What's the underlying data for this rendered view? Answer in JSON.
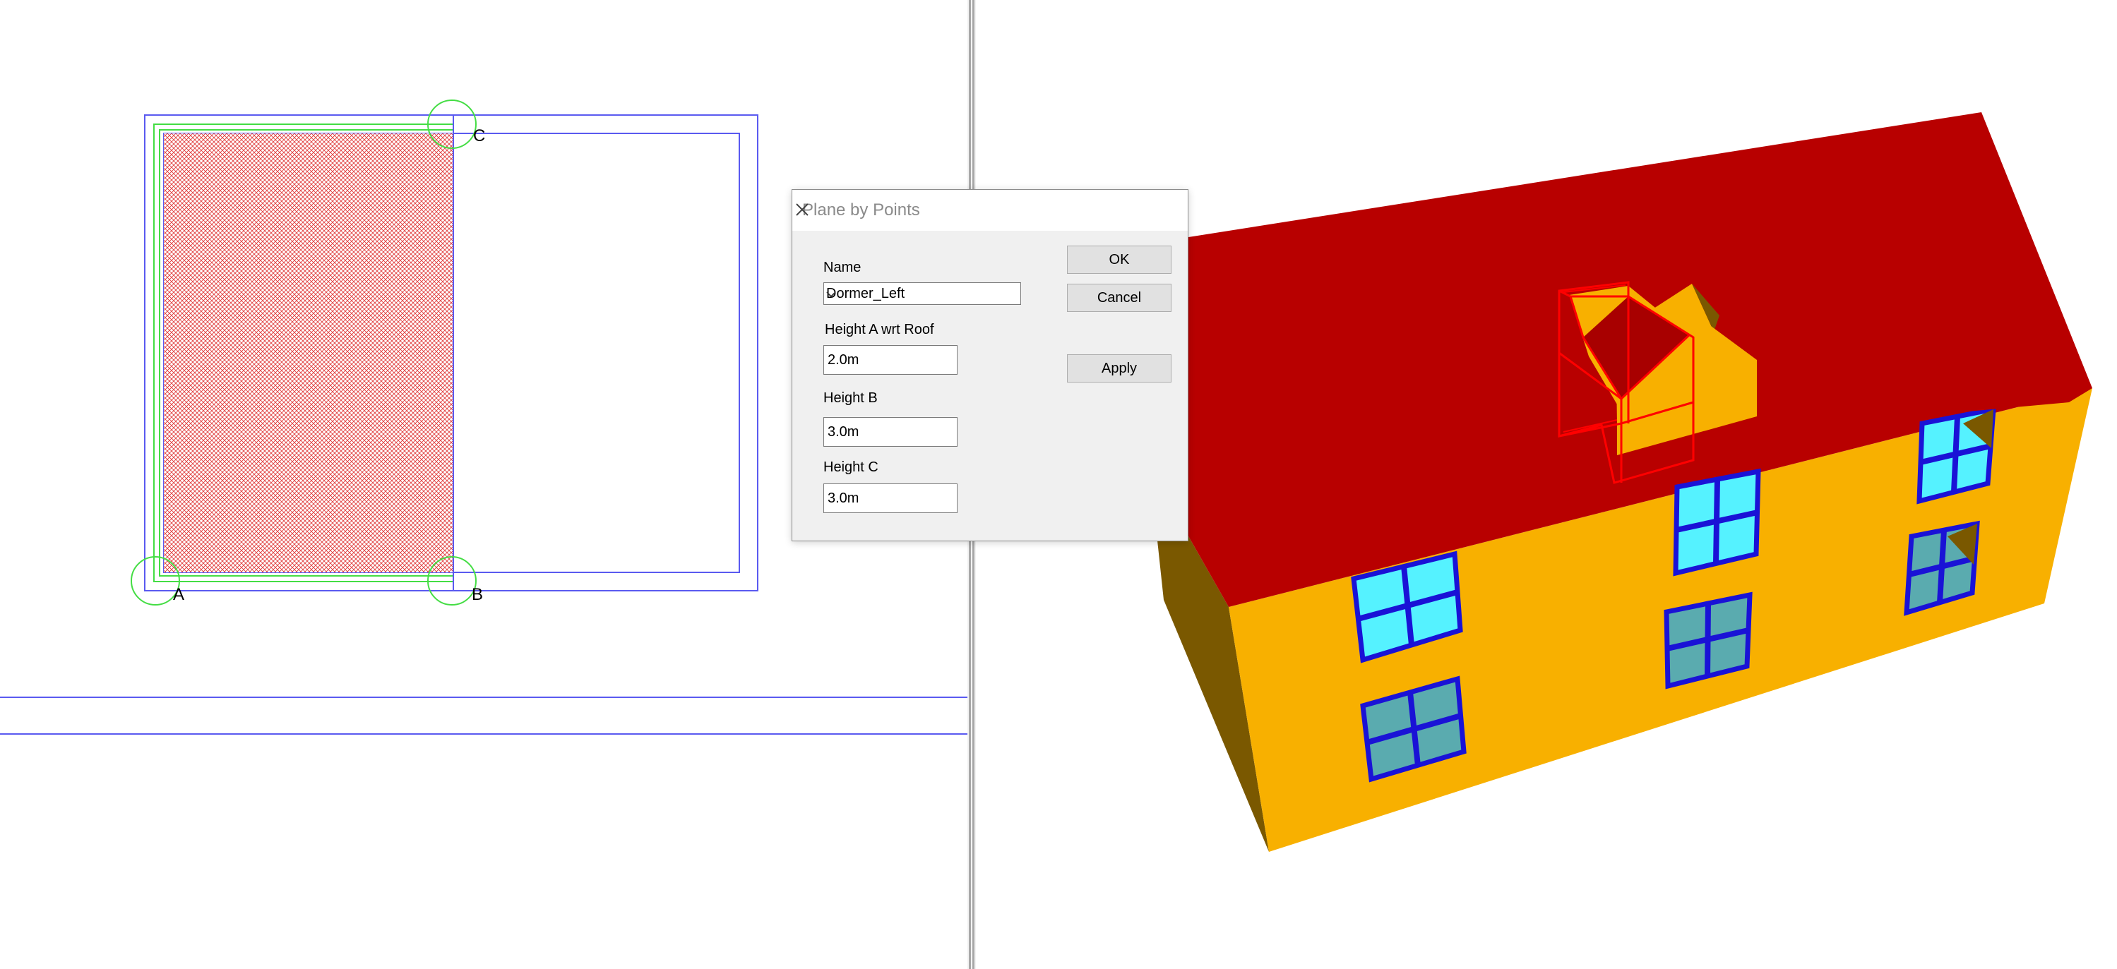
{
  "plan_view": {
    "points": {
      "a": "A",
      "b": "B",
      "c": "C"
    }
  },
  "dialog": {
    "title": "Plane by Points",
    "name_label": "Name",
    "name_value": "Dormer_Left",
    "height_a_label": "Height A wrt Roof",
    "height_a_value": "2.0m",
    "height_b_label": "Height B",
    "height_b_value": "3.0m",
    "height_c_label": "Height C",
    "height_c_value": "3.0m",
    "ok_label": "OK",
    "cancel_label": "Cancel",
    "apply_label": "Apply"
  },
  "colors": {
    "roof": "#b80000",
    "wall": "#f8b000",
    "wall_shadow": "#7a5800",
    "window_glass": "#55f2ff",
    "window_glass_shaded": "#5aabaf",
    "window_frame": "#1a12d6",
    "selection": "#ff0000",
    "guide_blue": "#5a5af0",
    "guide_green": "#44dd44"
  }
}
